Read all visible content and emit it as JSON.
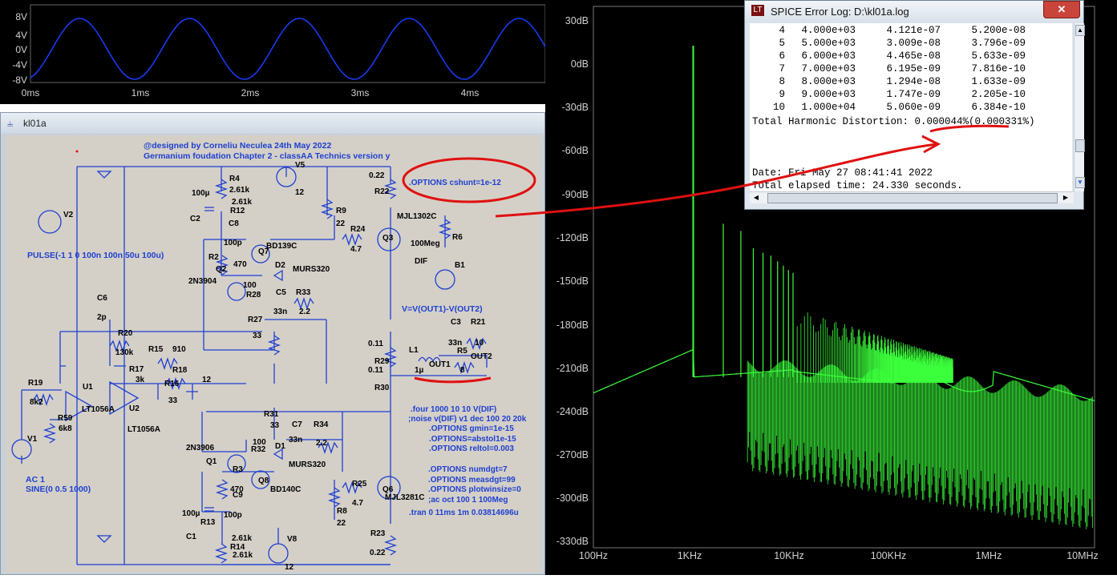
{
  "wave": {
    "y_labels": [
      "8V",
      "4V",
      "0V",
      "-4V",
      "-8V"
    ],
    "x_labels": [
      "0ms",
      "1ms",
      "2ms",
      "3ms",
      "4ms"
    ],
    "trace_color": "#1a3cff"
  },
  "fft": {
    "y_labels": [
      "30dB",
      "0dB",
      "-30dB",
      "-60dB",
      "-90dB",
      "-120dB",
      "-150dB",
      "-180dB",
      "-210dB",
      "-240dB",
      "-270dB",
      "-300dB",
      "-330dB"
    ],
    "x_labels": [
      "100Hz",
      "1KHz",
      "10KHz",
      "100KHz",
      "1MHz",
      "10MHz"
    ],
    "trace_color": "#3cff3c"
  },
  "schematic": {
    "window_title": "kl01a",
    "header_line1": "@designed by Corneliu Neculea 24th May 2022",
    "header_line2": "Germanium foudation Chapter 2 - classAA Technics version y",
    "options_cshunt": ".OPTIONS cshunt=1e-12",
    "pulse": "PULSE(-1 1 0 100n 100n 50u 100u)",
    "v_expr": "V=V(OUT1)-V(OUT2)",
    "ac_label": "AC 1",
    "sine_label": "SINE(0 0.5 1000)",
    "directives": [
      ".four 1000 10 10 V(DIF)",
      ";noise v(DIF) v1 dec 100 20 20k",
      ".OPTIONS gmin=1e-15",
      ".OPTIONS=abstol1e-15",
      ".OPTIONS reltol=0.003",
      ".OPTIONS numdgt=7",
      ".OPTIONS measdgt=99",
      ".OPTIONS plotwinsize=0",
      ";ac oct 100 1 100Meg",
      ".tran 0 11ms 1m 0.03814696u"
    ],
    "labels": {
      "R4": "R4",
      "R4v": "2.61k",
      "R12v": "2.61k",
      "R12": "R12",
      "C2v": "100µ",
      "C2": "C2",
      "C8": "C8",
      "C8v": "100p",
      "V5": "V5",
      "V5v": "12",
      "R22v": "0.22",
      "R22": "R22",
      "R9": "R9",
      "R9v": "22",
      "R24": "R24",
      "R24v": "4.7",
      "Q3": "Q3",
      "MJL1302C": "MJL1302C",
      "R6v": "100Meg",
      "R6": "R6",
      "DIF": "DIF",
      "B1": "B1",
      "V2": "V2",
      "R2": "R2",
      "R2v": "470",
      "Q7": "Q7",
      "BD139C": "BD139C",
      "D2": "D2",
      "MURS320a": "MURS320",
      "Q2": "Q2",
      "N3904": "2N3904",
      "R28v": "100",
      "R28": "R28",
      "C5": "C5",
      "R33": "R33",
      "C5v": "33n",
      "R33v": "2.2",
      "C6": "C6",
      "C6v": "2p",
      "R20": "R20",
      "R20v": "130k",
      "R27": "R27",
      "R27v": "33",
      "C3": "C3",
      "R21": "R21",
      "C3v": "33n",
      "R21v": "10",
      "R15": "R15",
      "R15v": "910",
      "R17": "R17",
      "R17v": "3k",
      "R18": "R18",
      "R18v": "12",
      "R16": "R16",
      "R16v": "33",
      "R011a": "0.11",
      "L1": "L1",
      "R5": "R5",
      "OUT2": "OUT2",
      "R29": "R29",
      "L1v": "1µ",
      "OUT1": "OUT1",
      "R5v": "8",
      "R011b": "0.11",
      "R30": "R30",
      "R19": "R19",
      "R19v": "8k2",
      "U1": "U1",
      "LT1056A1": "LT1056A",
      "U2": "U2",
      "LT1056A2": "LT1056A",
      "R59": "R59",
      "R59v": "6k8",
      "V1": "V1",
      "R31": "R31",
      "R31v": "33",
      "C7": "C7",
      "R34": "R34",
      "C7v": "33n",
      "R34v": "2.2",
      "N3906": "2N3906",
      "R32v": "100",
      "R32": "R32",
      "D1": "D1",
      "Q1": "Q1",
      "MURS320b": "MURS320",
      "R3": "R3",
      "R3v": "470",
      "Q8": "Q8",
      "BD140C": "BD140C",
      "C9": "C9",
      "C9v": "100p",
      "R25": "R25",
      "R25v": "4.7",
      "Q6": "Q6",
      "MJL3281C": "MJL3281C",
      "C1v": "100µ",
      "R8": "R8",
      "R8v": "22",
      "C1": "C1",
      "R13": "R13",
      "R13v": "2.61k",
      "R14": "R14",
      "R14v": "2.61k",
      "V8": "V8",
      "V8v": "12",
      "R23": "R23",
      "R23v": "0.22"
    }
  },
  "log": {
    "title": "SPICE Error Log: D:\\kl01a.log",
    "rows": [
      {
        "n": "4",
        "f": "4.000e+03",
        "a": "4.121e-07",
        "b": "5.200e-08"
      },
      {
        "n": "5",
        "f": "5.000e+03",
        "a": "3.009e-08",
        "b": "3.796e-09"
      },
      {
        "n": "6",
        "f": "6.000e+03",
        "a": "4.465e-08",
        "b": "5.633e-09"
      },
      {
        "n": "7",
        "f": "7.000e+03",
        "a": "6.195e-09",
        "b": "7.816e-10"
      },
      {
        "n": "8",
        "f": "8.000e+03",
        "a": "1.294e-08",
        "b": "1.633e-09"
      },
      {
        "n": "9",
        "f": "9.000e+03",
        "a": "1.747e-09",
        "b": "2.205e-10"
      },
      {
        "n": "10",
        "f": "1.000e+04",
        "a": "5.060e-09",
        "b": "6.384e-10"
      }
    ],
    "thd": "Total Harmonic Distortion: 0.000044%(0.000331%)",
    "date": "Date: Fri May 27 08:41:41 2022",
    "elapsed": "Total elapsed time: 24.330 seconds."
  },
  "colors": {
    "wire": "#1f3fd0",
    "annotation": "#e01010",
    "schematic_bg": "#d4d0c8"
  }
}
